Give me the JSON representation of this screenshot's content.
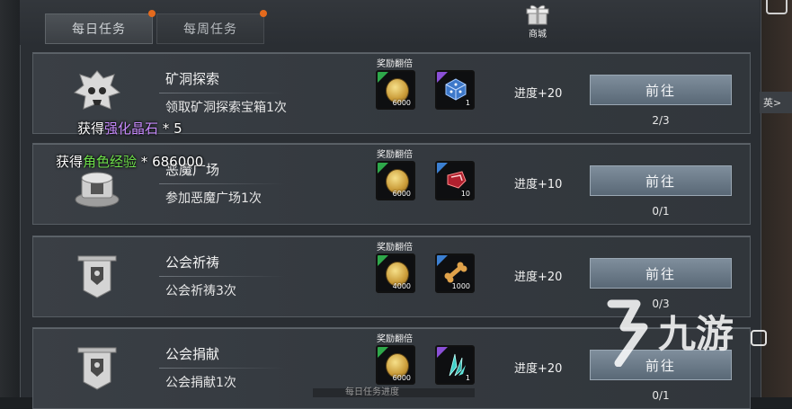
{
  "tabs": {
    "daily": "每日任务",
    "weekly": "每周任务"
  },
  "shop_label": "商城",
  "side_text": "英>",
  "reward_label": "奖励翻倍",
  "go_label": "前往",
  "tasks": [
    {
      "title": "矿洞探索",
      "desc": "领取矿洞探索宝箱1次",
      "reward1_qty": "6000",
      "reward2_qty": "1",
      "reward2_icon": "dice-box-icon",
      "progress": "进度+20",
      "count": "2/3"
    },
    {
      "title": "恶魔广场",
      "desc": "参加恶魔广场1次",
      "reward1_qty": "6000",
      "reward2_qty": "10",
      "reward2_icon": "red-gem-icon",
      "progress": "进度+10",
      "count": "0/1"
    },
    {
      "title": "公会祈祷",
      "desc": "公会祈祷3次",
      "reward1_qty": "4000",
      "reward2_qty": "1000",
      "reward2_icon": "bone-icon",
      "progress": "进度+20",
      "count": "0/3"
    },
    {
      "title": "公会捐献",
      "desc": "公会捐献1次",
      "reward1_qty": "6000",
      "reward2_qty": "1",
      "reward2_icon": "crystal-shard-icon",
      "progress": "进度+20",
      "count": "0/1"
    }
  ],
  "popups": {
    "first": {
      "prefix": "获得",
      "item": "强化晶石",
      "suffix": " * 5"
    },
    "second": {
      "prefix": "获得",
      "item": "角色经验",
      "suffix": " * 686000"
    }
  },
  "bottom_peek": "每日任务进度",
  "watermark": "九游",
  "colors": {
    "accent_purple": "#c98cff",
    "accent_green": "#6ee04b",
    "button": "#6d7c8a"
  }
}
